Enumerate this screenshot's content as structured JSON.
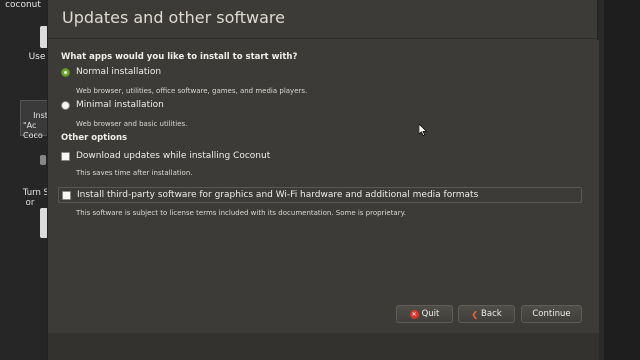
{
  "desktop": {
    "items": [
      {
        "label": "coconut"
      },
      {
        "label": "Use"
      },
      {
        "label": "Install\n\"Ac\nCoco"
      },
      {
        "label": "Turn Scr\nor"
      }
    ]
  },
  "window": {
    "title": "Updates and other software",
    "question": "What apps would you like to install to start with?",
    "normal": {
      "label": "Normal installation",
      "desc": "Web browser, utilities, office software, games, and media players.",
      "selected": true
    },
    "minimal": {
      "label": "Minimal installation",
      "desc": "Web browser and basic utilities.",
      "selected": false
    },
    "other_heading": "Other options",
    "download": {
      "label": "Download updates while installing Coconut",
      "desc": "This saves time after installation.",
      "checked": false
    },
    "thirdparty": {
      "label": "Install third-party software for graphics and Wi-Fi hardware and additional media formats",
      "desc": "This software is subject to license terms included with its documentation. Some is proprietary.",
      "checked": false
    },
    "buttons": {
      "quit": "Quit",
      "back": "Back",
      "continue": "Continue"
    }
  },
  "colors": {
    "accent_radio": "#6fa631",
    "window_bg": "#3c3b37",
    "quit_icon": "#d8372b",
    "back_icon": "#e96c2b"
  }
}
